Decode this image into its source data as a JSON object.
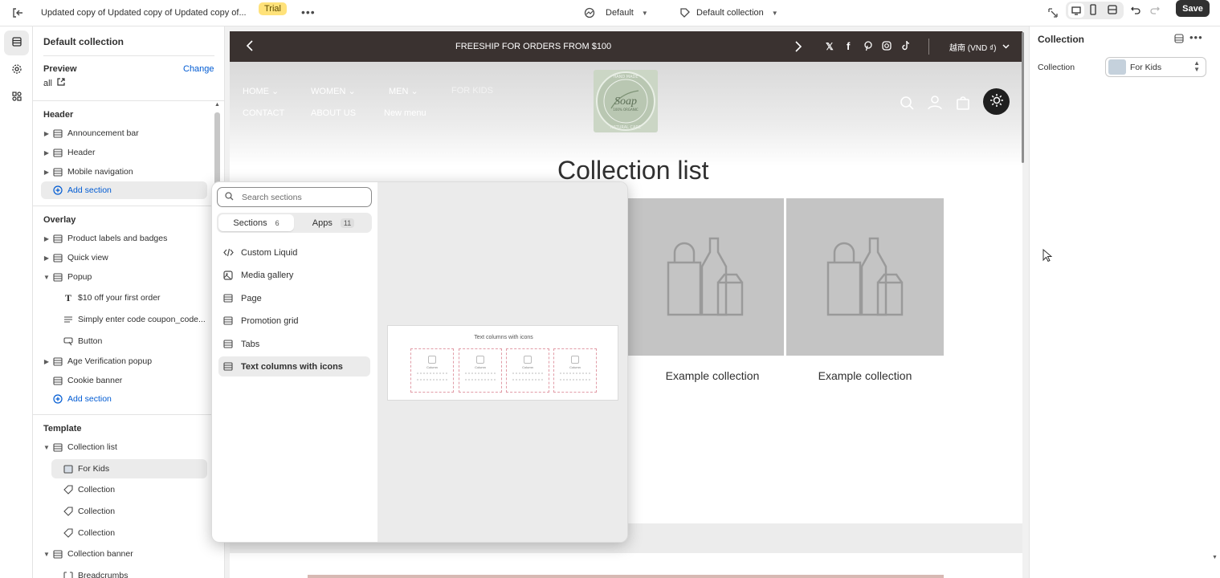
{
  "topbar": {
    "title": "Updated copy of Updated copy of Updated copy of...",
    "badge": "Trial",
    "theme": "Default",
    "template": "Default collection",
    "save_label": "Save"
  },
  "left_panel": {
    "title": "Default collection",
    "preview_label": "Preview",
    "change_label": "Change",
    "preview_value": "all",
    "groups": {
      "header": {
        "label": "Header",
        "items": [
          "Announcement bar",
          "Header",
          "Mobile navigation"
        ],
        "add": "Add section"
      },
      "overlay": {
        "label": "Overlay",
        "items": [
          "Product labels and badges",
          "Quick view",
          "Popup"
        ],
        "popup_children": [
          "$10 off your first order",
          "Simply enter code coupon_code...",
          "Button"
        ],
        "items2": [
          "Age Verification popup",
          "Cookie banner"
        ],
        "add": "Add section"
      },
      "template": {
        "label": "Template",
        "collection_list": "Collection list",
        "children": [
          "For Kids",
          "Collection",
          "Collection",
          "Collection"
        ],
        "collection_banner": "Collection banner",
        "breadcrumbs": "Breadcrumbs"
      }
    }
  },
  "preview": {
    "announcement": "FREESHIP FOR ORDERS FROM $100",
    "currency": "越南 (VND ₫)",
    "nav": [
      "HOME",
      "WOMEN",
      "MEN",
      "FOR KIDS",
      "CONTACT",
      "ABOUT US",
      "New menu"
    ],
    "logo_text": {
      "top": "HAND MADE",
      "main": "Soap",
      "sub": "100% ORGANIC",
      "bottom": "NATURAL CARE"
    },
    "heading": "Collection list",
    "cards": [
      "Example collection",
      "Example collection"
    ]
  },
  "popover": {
    "search_placeholder": "Search sections",
    "tab_sections": "Sections",
    "tab_sections_count": "6",
    "tab_apps": "Apps",
    "tab_apps_count": "11",
    "items": [
      "Custom Liquid",
      "Media gallery",
      "Page",
      "Promotion grid",
      "Tabs",
      "Text columns with icons"
    ],
    "preview_title": "Text columns with icons",
    "preview_col": "Column"
  },
  "right_panel": {
    "title": "Collection",
    "field_label": "Collection",
    "field_value": "For Kids"
  },
  "colors": {
    "accent": "#005bd3",
    "dark": "#303030",
    "announcement_bg": "#3a3230",
    "trial": "#ffe27a"
  }
}
